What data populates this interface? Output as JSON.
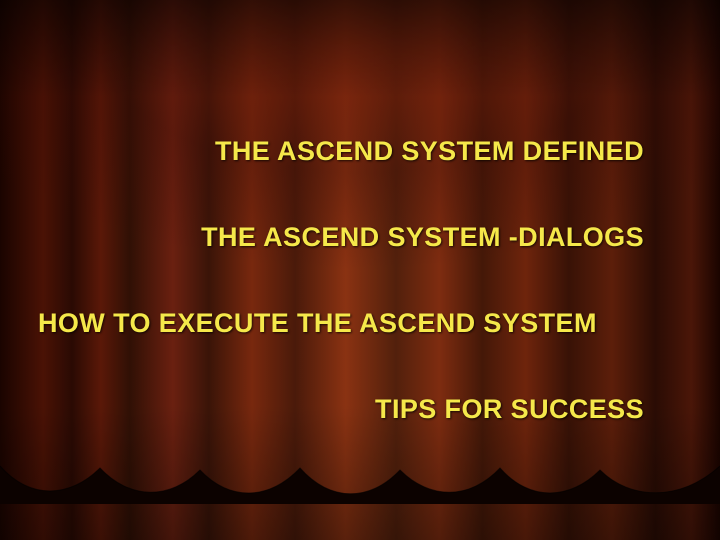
{
  "slide": {
    "lines": [
      "THE ASCEND SYSTEM DEFINED",
      "THE ASCEND SYSTEM -DIALOGS",
      "HOW TO EXECUTE THE ASCEND SYSTEM",
      "TIPS FOR SUCCESS"
    ]
  },
  "colors": {
    "text": "#f5e84a",
    "curtain_dark": "#1a0400",
    "curtain_mid": "#6a2010",
    "curtain_light": "#8a3212"
  }
}
